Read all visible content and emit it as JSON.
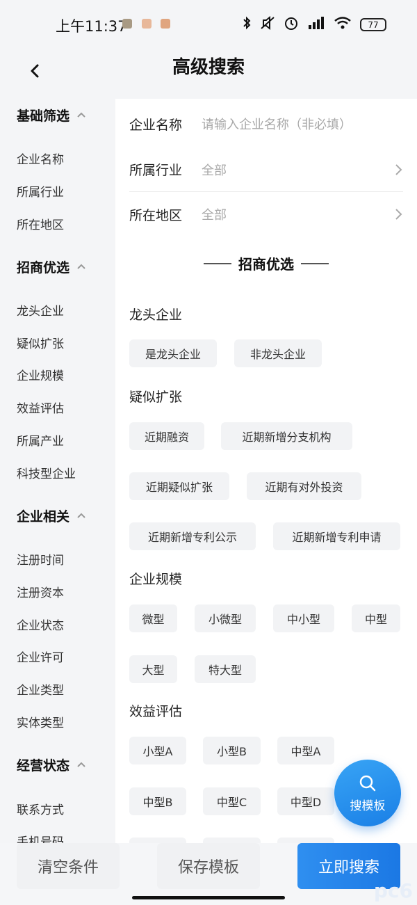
{
  "status": {
    "time": "上午11:37",
    "battery": "77"
  },
  "header": {
    "title": "高级搜索"
  },
  "sidebar": {
    "groups": [
      {
        "label": "基础筛选",
        "items": [
          "企业名称",
          "所属行业",
          "所在地区"
        ]
      },
      {
        "label": "招商优选",
        "items": [
          "龙头企业",
          "疑似扩张",
          "企业规模",
          "效益评估",
          "所属产业",
          "科技型企业"
        ]
      },
      {
        "label": "企业相关",
        "items": [
          "注册时间",
          "注册资本",
          "企业状态",
          "企业许可",
          "企业类型",
          "实体类型"
        ]
      },
      {
        "label": "经营状态",
        "items": [
          "联系方式",
          "手机号码"
        ]
      }
    ]
  },
  "form": {
    "company_name": {
      "label": "企业名称",
      "placeholder": "请输入企业名称（非必填）"
    },
    "industry": {
      "label": "所属行业",
      "value": "全部"
    },
    "region": {
      "label": "所在地区",
      "value": "全部"
    }
  },
  "section": {
    "title": "招商优选",
    "categories": [
      {
        "title": "龙头企业",
        "chips": [
          "是龙头企业",
          "非龙头企业"
        ]
      },
      {
        "title": "疑似扩张",
        "chips": [
          "近期融资",
          "近期新增分支机构",
          "近期疑似扩张",
          "近期有对外投资",
          "近期新增专利公示",
          "近期新增专利申请"
        ]
      },
      {
        "title": "企业规模",
        "chips": [
          "微型",
          "小微型",
          "中小型",
          "中型",
          "大型",
          "特大型"
        ]
      },
      {
        "title": "效益评估",
        "chips": [
          "小型A",
          "小型B",
          "中型A",
          "中型B",
          "中型C",
          "中型D"
        ]
      }
    ]
  },
  "fab": {
    "label": "搜模板",
    "icon": "search-icon"
  },
  "bottom": {
    "clear": "清空条件",
    "save": "保存模板",
    "search": "立即搜索"
  },
  "watermark": "pc6",
  "colors": {
    "primary": "#1f80e8",
    "chip_bg": "#f2f3f5",
    "sidebar_bg": "#f4f5f7"
  }
}
